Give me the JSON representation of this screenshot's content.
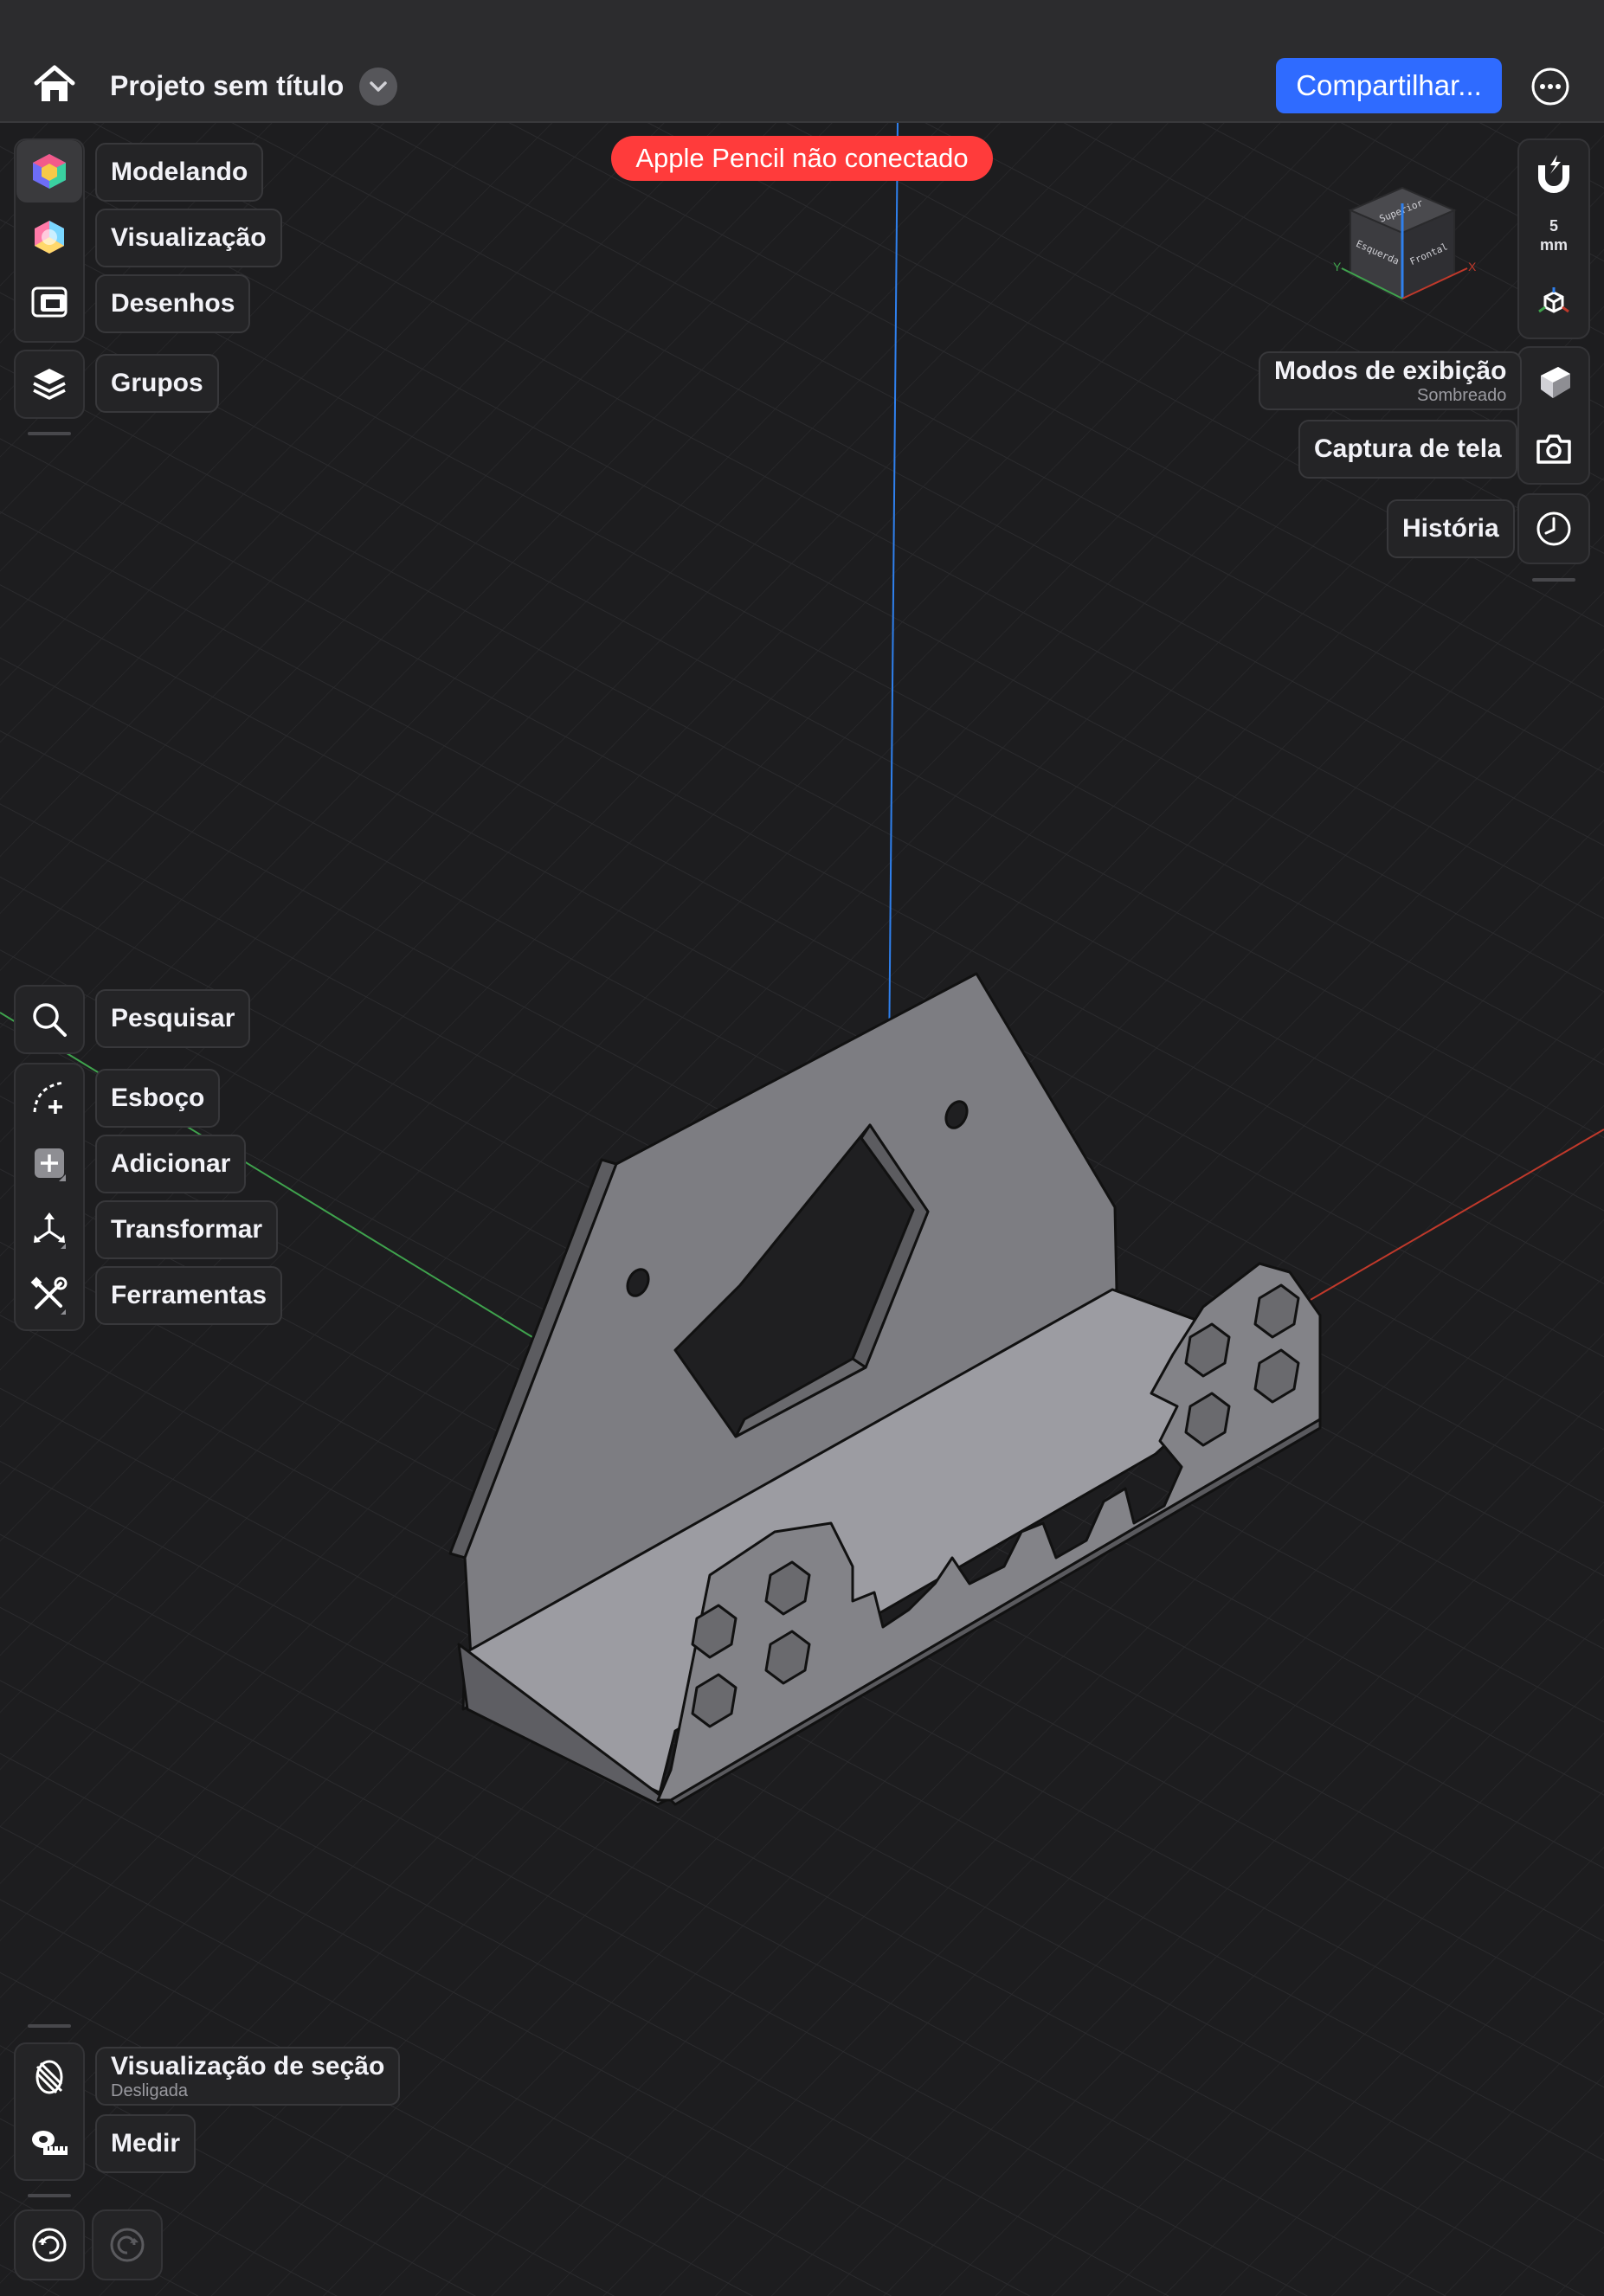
{
  "topbar": {
    "project_title": "Projeto sem título",
    "share_label": "Compartilhar...",
    "icons": [
      "home-icon",
      "chevron-down-icon",
      "more-icon"
    ]
  },
  "banner": {
    "pencil_status": "Apple Pencil não conectado",
    "color": "#ff3b3b"
  },
  "left_toolbar": {
    "workspaces": [
      {
        "label": "Modelando",
        "icon": "modeling-cube-icon",
        "active": true
      },
      {
        "label": "Visualização",
        "icon": "visualization-sphere-icon",
        "active": false
      },
      {
        "label": "Desenhos",
        "icon": "drawings-icon",
        "active": false
      }
    ],
    "groups": {
      "label": "Grupos",
      "icon": "layers-icon"
    },
    "tools": [
      {
        "label": "Pesquisar",
        "icon": "search-icon"
      },
      {
        "label": "Esboço",
        "icon": "sketch-icon"
      },
      {
        "label": "Adicionar",
        "icon": "add-icon"
      },
      {
        "label": "Transformar",
        "icon": "transform-icon"
      },
      {
        "label": "Ferramentas",
        "icon": "tools-icon"
      }
    ],
    "section_view": {
      "label": "Visualização de seção",
      "status": "Desligada",
      "icon": "section-view-icon"
    },
    "measure": {
      "label": "Medir",
      "icon": "tape-measure-icon"
    },
    "history_nav": {
      "undo_icon": "undo-icon",
      "redo_icon": "redo-icon"
    }
  },
  "right_toolbar": {
    "snap": {
      "value": "5",
      "unit": "mm",
      "icon": "magnet-icon"
    },
    "view_cube": {
      "top": "Superior",
      "left": "Esquerda",
      "front": "Frontal",
      "axis_x": "X",
      "axis_y": "Y"
    },
    "display_modes": {
      "label": "Modos de exibição",
      "status": "Sombreado",
      "icon": "shaded-mode-icon"
    },
    "screenshot": {
      "label": "Captura de tela",
      "icon": "camera-icon"
    },
    "history": {
      "label": "História",
      "icon": "clock-icon"
    }
  },
  "colors": {
    "accent": "#2f6bff",
    "alert": "#ff3b3b",
    "axis_x": "#c0392b",
    "axis_y": "#3fa34d",
    "axis_z": "#2f80ed",
    "background": "#1d1d1f",
    "model": "#8e8e93"
  }
}
